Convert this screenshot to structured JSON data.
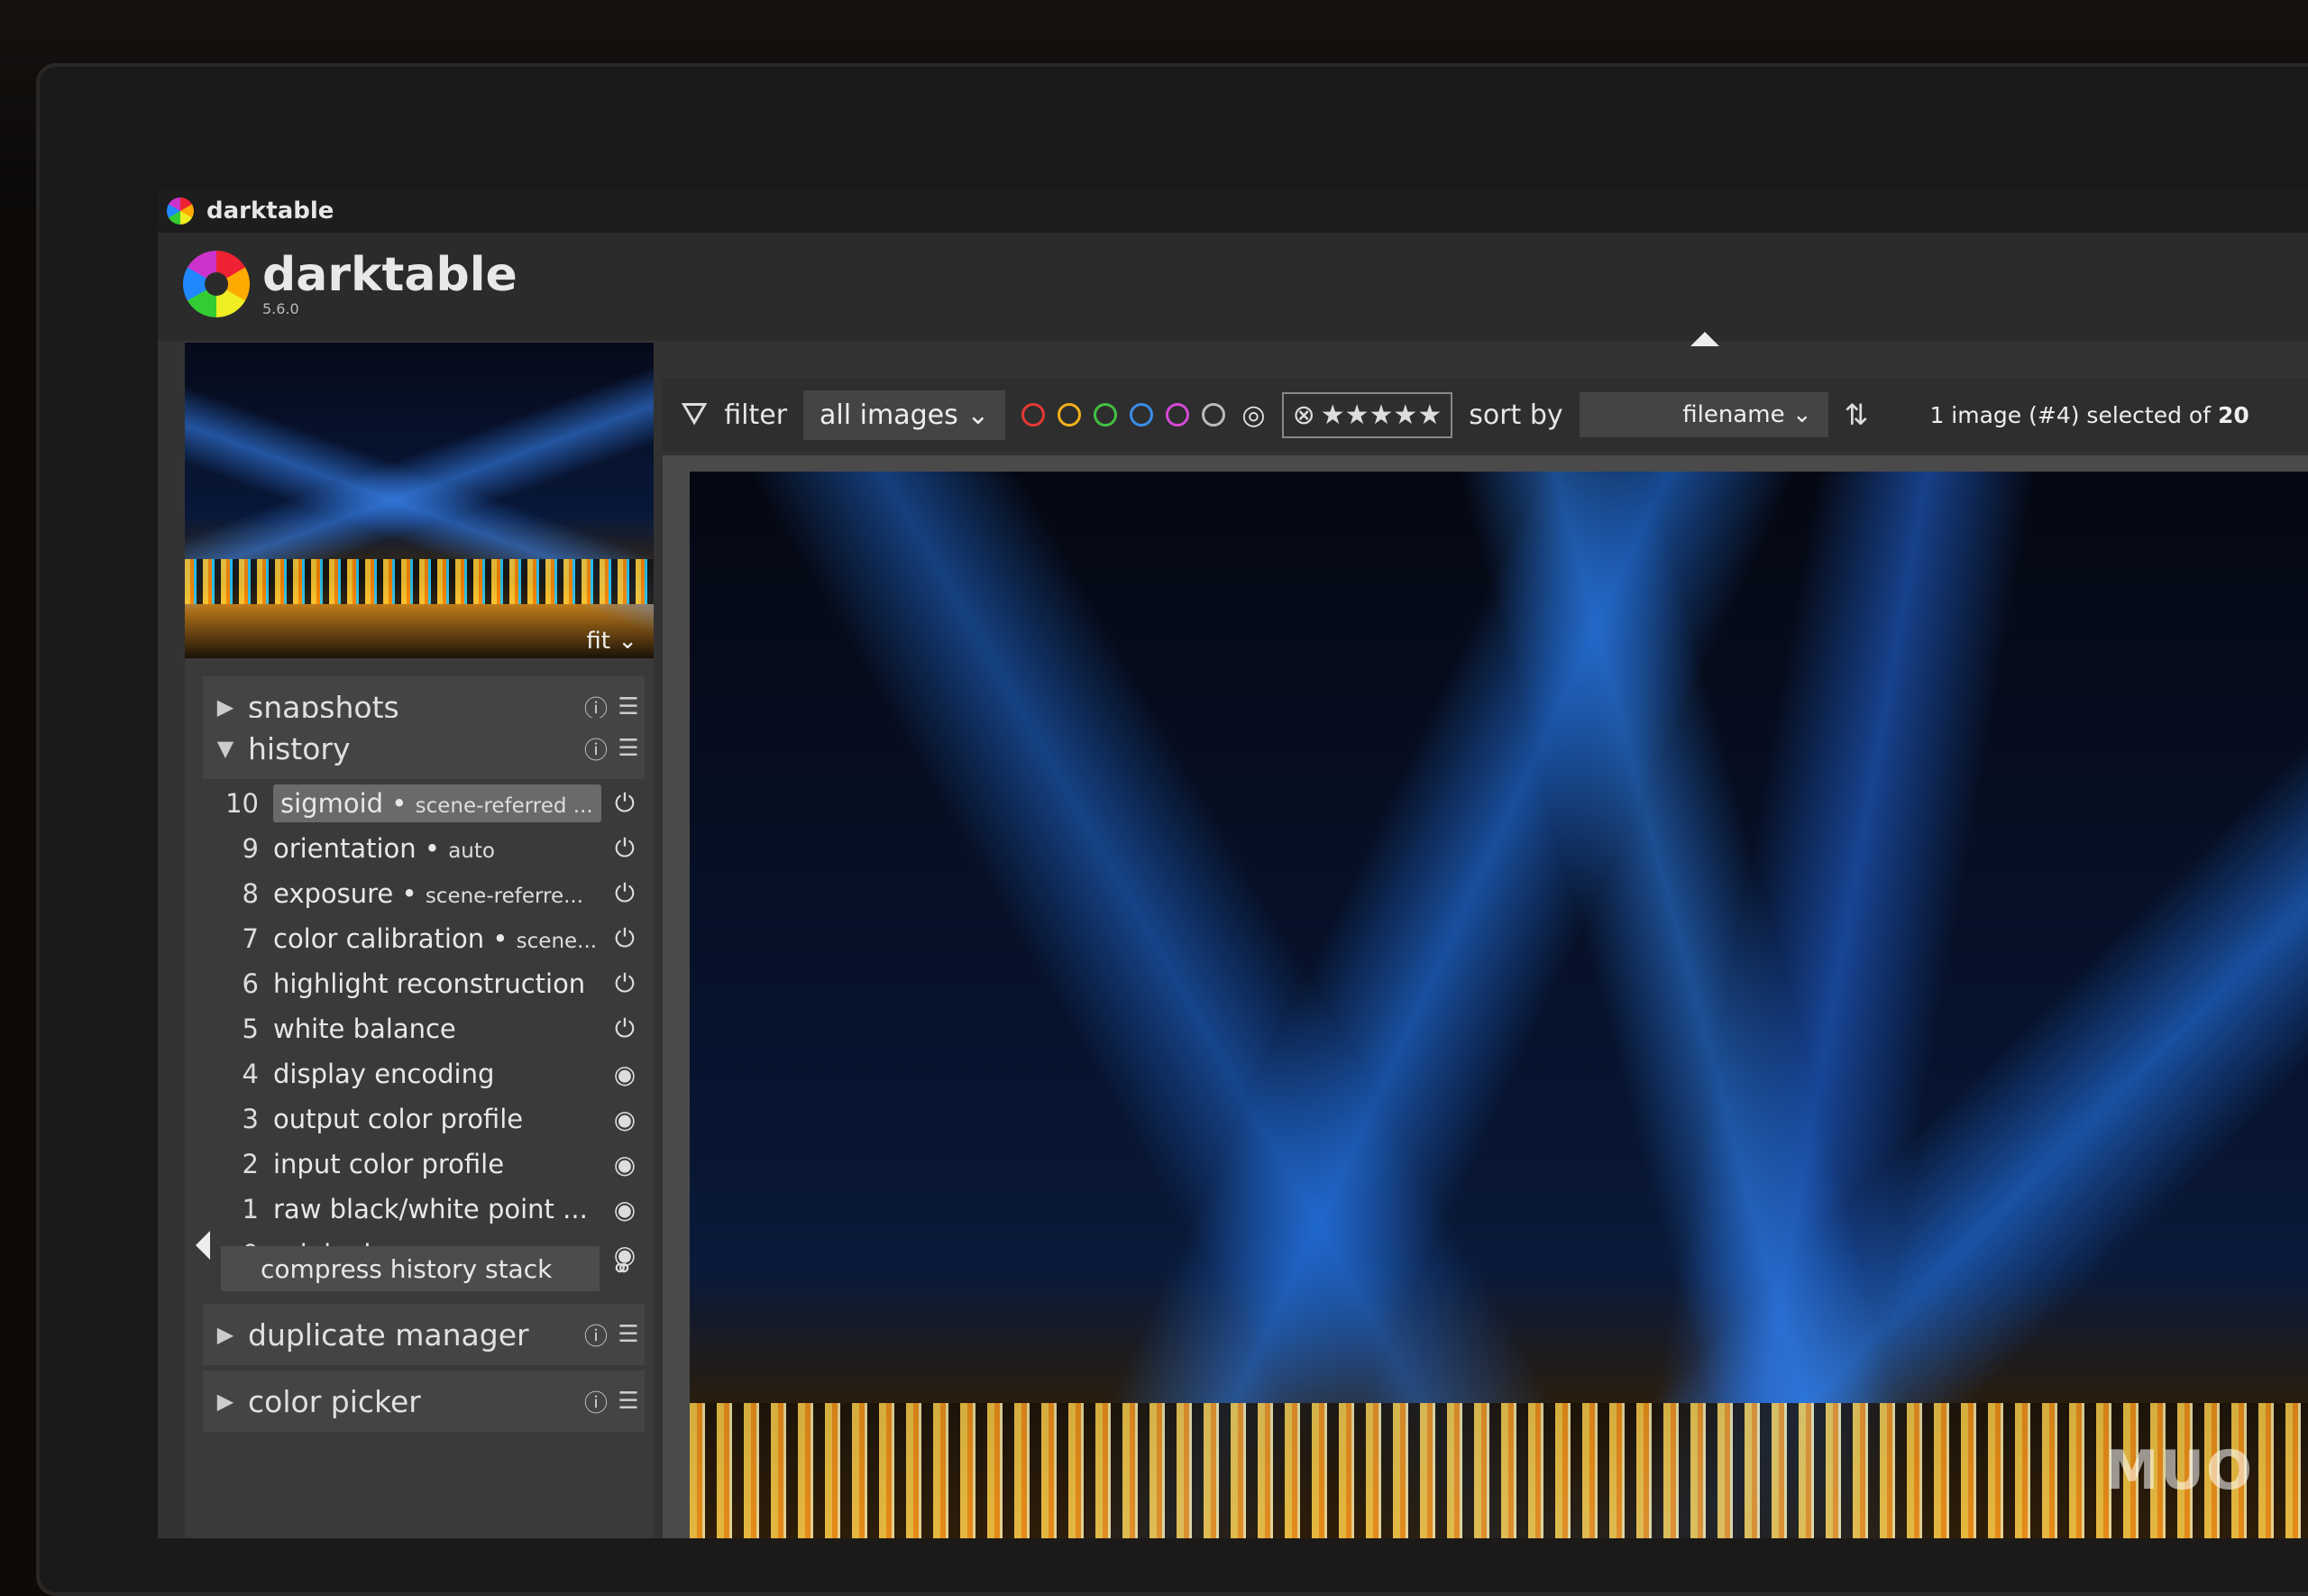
{
  "window": {
    "title": "darktable"
  },
  "header": {
    "app_name": "darktable",
    "version": "5.6.0"
  },
  "navigation": {
    "zoom": "fit"
  },
  "modules": {
    "snapshots": "snapshots",
    "history": "history",
    "duplicate_manager": "duplicate manager",
    "color_picker": "color picker"
  },
  "history": {
    "items": [
      {
        "num": "10",
        "name": "sigmoid",
        "detail": "scene-referred ...",
        "state": "power"
      },
      {
        "num": "9",
        "name": "orientation",
        "detail": "auto",
        "state": "power"
      },
      {
        "num": "8",
        "name": "exposure",
        "detail": "scene-referre...",
        "state": "power"
      },
      {
        "num": "7",
        "name": "color calibration",
        "detail": "scene...",
        "state": "power"
      },
      {
        "num": "6",
        "name": "highlight reconstruction",
        "detail": "",
        "state": "power"
      },
      {
        "num": "5",
        "name": "white balance",
        "detail": "",
        "state": "power"
      },
      {
        "num": "4",
        "name": "display encoding",
        "detail": "",
        "state": "always-on"
      },
      {
        "num": "3",
        "name": "output color profile",
        "detail": "",
        "state": "always-on"
      },
      {
        "num": "2",
        "name": "input color profile",
        "detail": "",
        "state": "always-on"
      },
      {
        "num": "1",
        "name": "raw black/white point ...",
        "detail": "",
        "state": "always-on"
      },
      {
        "num": "0",
        "name": "original",
        "detail": "",
        "state": "always-on"
      }
    ],
    "compress_label": "compress history stack"
  },
  "toolbar": {
    "filter_label": "filter",
    "filter_value": "all images",
    "color_labels": [
      "#e53935",
      "#f2b21b",
      "#43c043",
      "#3a8ee8",
      "#d44ad4",
      "#bbbbbb"
    ],
    "sort_label": "sort by",
    "sort_value": "filename",
    "selection_prefix": "1 image (#4) selected of",
    "selection_total": "20"
  },
  "watermark": "MUO"
}
